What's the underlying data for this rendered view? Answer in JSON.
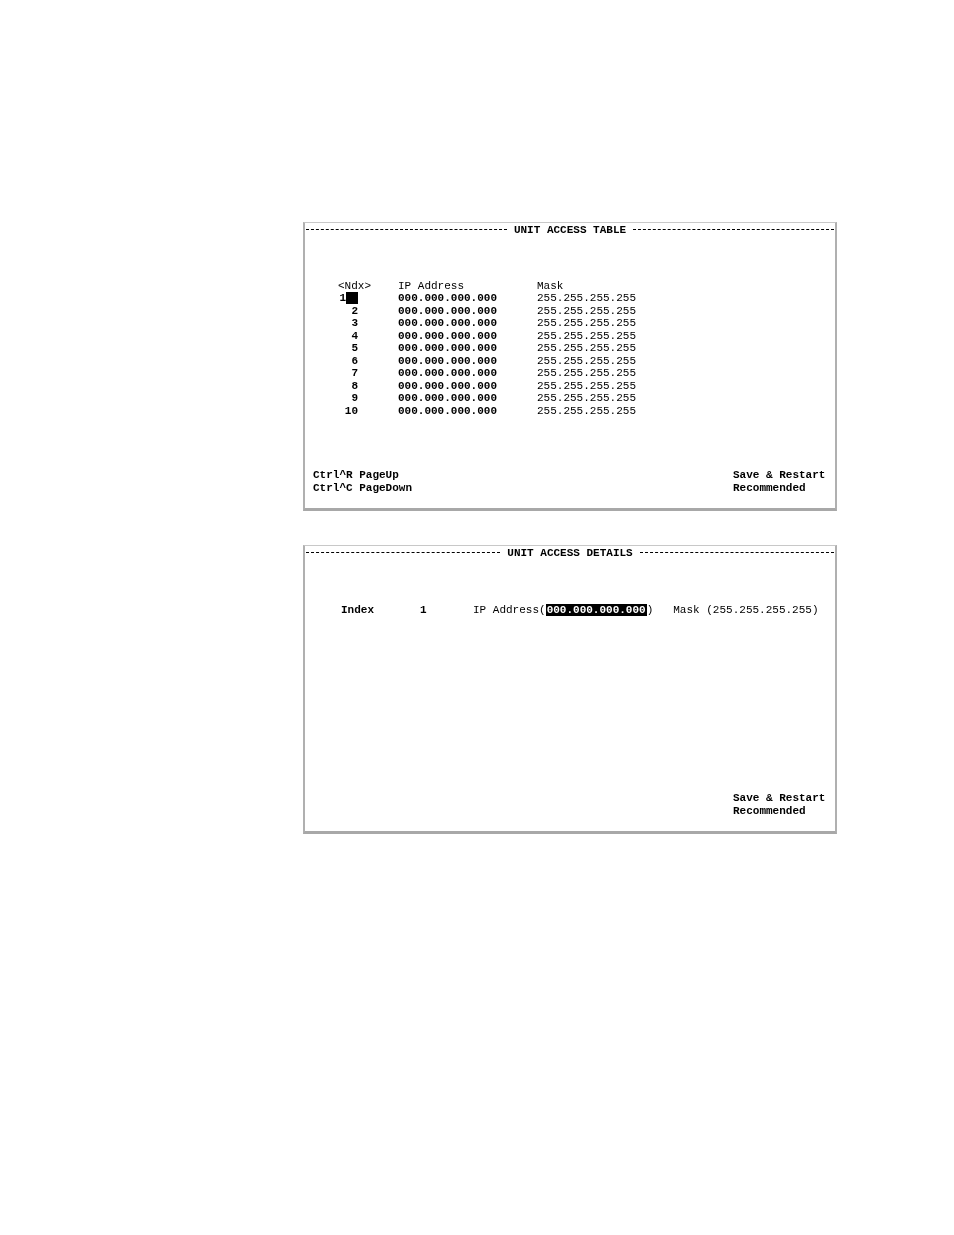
{
  "table_screen": {
    "title": "UNIT ACCESS TABLE",
    "columns": [
      "<Ndx>",
      "IP Address",
      "Mask"
    ],
    "rows": [
      {
        "index": "1",
        "ip_address": "000.000.000.000",
        "mask": "255.255.255.255",
        "selected": true
      },
      {
        "index": "2",
        "ip_address": "000.000.000.000",
        "mask": "255.255.255.255",
        "selected": false
      },
      {
        "index": "3",
        "ip_address": "000.000.000.000",
        "mask": "255.255.255.255",
        "selected": false
      },
      {
        "index": "4",
        "ip_address": "000.000.000.000",
        "mask": "255.255.255.255",
        "selected": false
      },
      {
        "index": "5",
        "ip_address": "000.000.000.000",
        "mask": "255.255.255.255",
        "selected": false
      },
      {
        "index": "6",
        "ip_address": "000.000.000.000",
        "mask": "255.255.255.255",
        "selected": false
      },
      {
        "index": "7",
        "ip_address": "000.000.000.000",
        "mask": "255.255.255.255",
        "selected": false
      },
      {
        "index": "8",
        "ip_address": "000.000.000.000",
        "mask": "255.255.255.255",
        "selected": false
      },
      {
        "index": "9",
        "ip_address": "000.000.000.000",
        "mask": "255.255.255.255",
        "selected": false
      },
      {
        "index": "10",
        "ip_address": "000.000.000.000",
        "mask": "255.255.255.255",
        "selected": false
      }
    ],
    "shortcuts": [
      "Ctrl^R PageUp",
      "Ctrl^C PageDown"
    ],
    "notice": [
      "Save & Restart",
      "Recommended"
    ]
  },
  "details_screen": {
    "title": "UNIT ACCESS DETAILS",
    "index_label": "Index",
    "index_value": "1",
    "ip_label": "IP Address(",
    "ip_value": "000.000.000.000",
    "ip_selected": true,
    "ip_close": ")",
    "mask_text": "Mask (255.255.255.255)",
    "notice": [
      "Save & Restart",
      "Recommended"
    ]
  }
}
